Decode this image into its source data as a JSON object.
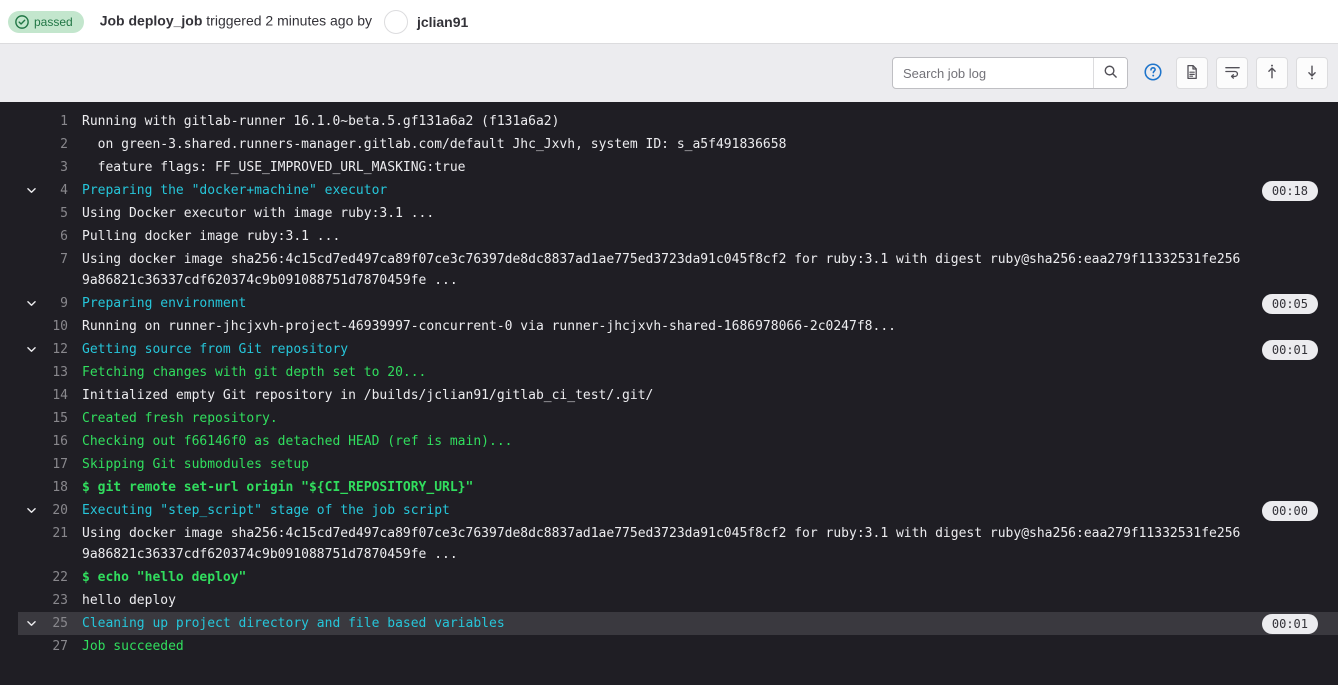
{
  "header": {
    "status_label": "passed",
    "status_icon": "check-circle-icon",
    "status_bg": "#c3e6cd",
    "status_fg": "#217645",
    "job_label": "Job deploy_job",
    "triggered_text": " triggered 2 minutes ago by ",
    "author": "jclian91"
  },
  "toolbar": {
    "search_placeholder": "Search job log",
    "search_value": "",
    "search_icon": "search-icon",
    "help_icon": "question-circle-icon",
    "raw_icon": "document-icon",
    "wrap_icon": "soft-wrap-icon",
    "scroll_top_icon": "scroll-to-top-icon",
    "scroll_bottom_icon": "scroll-to-bottom-icon"
  },
  "log": {
    "lines": [
      {
        "num": "1",
        "text": "Running with gitlab-runner 16.1.0~beta.5.gf131a6a2 (f131a6a2)",
        "style": "c-default",
        "collapsible": false,
        "duration": ""
      },
      {
        "num": "2",
        "text": "  on green-3.shared.runners-manager.gitlab.com/default Jhc_Jxvh, system ID: s_a5f491836658",
        "style": "c-default",
        "collapsible": false,
        "duration": ""
      },
      {
        "num": "3",
        "text": "  feature flags: FF_USE_IMPROVED_URL_MASKING:true",
        "style": "c-default",
        "collapsible": false,
        "duration": ""
      },
      {
        "num": "4",
        "text": "Preparing the \"docker+machine\" executor",
        "style": "c-section",
        "collapsible": true,
        "duration": "00:18"
      },
      {
        "num": "5",
        "text": "Using Docker executor with image ruby:3.1 ...",
        "style": "c-default",
        "collapsible": false,
        "duration": ""
      },
      {
        "num": "6",
        "text": "Pulling docker image ruby:3.1 ...",
        "style": "c-default",
        "collapsible": false,
        "duration": ""
      },
      {
        "num": "7",
        "text": "Using docker image sha256:4c15cd7ed497ca89f07ce3c76397de8dc8837ad1ae775ed3723da91c045f8cf2 for ruby:3.1 with digest ruby@sha256:eaa279f11332531fe2569a86821c36337cdf620374c9b091088751d7870459fe ...",
        "style": "c-default",
        "collapsible": false,
        "duration": ""
      },
      {
        "num": "9",
        "text": "Preparing environment",
        "style": "c-section",
        "collapsible": true,
        "duration": "00:05"
      },
      {
        "num": "10",
        "text": "Running on runner-jhcjxvh-project-46939997-concurrent-0 via runner-jhcjxvh-shared-1686978066-2c0247f8...",
        "style": "c-default",
        "collapsible": false,
        "duration": ""
      },
      {
        "num": "12",
        "text": "Getting source from Git repository",
        "style": "c-section",
        "collapsible": true,
        "duration": "00:01"
      },
      {
        "num": "13",
        "text": "Fetching changes with git depth set to 20...",
        "style": "c-green",
        "collapsible": false,
        "duration": ""
      },
      {
        "num": "14",
        "text": "Initialized empty Git repository in /builds/jclian91/gitlab_ci_test/.git/",
        "style": "c-default",
        "collapsible": false,
        "duration": ""
      },
      {
        "num": "15",
        "text": "Created fresh repository.",
        "style": "c-green",
        "collapsible": false,
        "duration": ""
      },
      {
        "num": "16",
        "text": "Checking out f66146f0 as detached HEAD (ref is main)...",
        "style": "c-green",
        "collapsible": false,
        "duration": ""
      },
      {
        "num": "17",
        "text": "Skipping Git submodules setup",
        "style": "c-green",
        "collapsible": false,
        "duration": ""
      },
      {
        "num": "18",
        "text": "$ git remote set-url origin \"${CI_REPOSITORY_URL}\"",
        "style": "c-green-bold",
        "collapsible": false,
        "duration": ""
      },
      {
        "num": "20",
        "text": "Executing \"step_script\" stage of the job script",
        "style": "c-section",
        "collapsible": true,
        "duration": "00:00"
      },
      {
        "num": "21",
        "text": "Using docker image sha256:4c15cd7ed497ca89f07ce3c76397de8dc8837ad1ae775ed3723da91c045f8cf2 for ruby:3.1 with digest ruby@sha256:eaa279f11332531fe2569a86821c36337cdf620374c9b091088751d7870459fe ...",
        "style": "c-default",
        "collapsible": false,
        "duration": ""
      },
      {
        "num": "22",
        "text": "$ echo \"hello deploy\"",
        "style": "c-green-bold",
        "collapsible": false,
        "duration": ""
      },
      {
        "num": "23",
        "text": "hello deploy",
        "style": "c-default",
        "collapsible": false,
        "duration": ""
      },
      {
        "num": "25",
        "text": "Cleaning up project directory and file based variables",
        "style": "c-section",
        "collapsible": true,
        "duration": "00:01",
        "hovered": true
      },
      {
        "num": "27",
        "text": "Job succeeded",
        "style": "c-green",
        "collapsible": false,
        "duration": ""
      }
    ]
  },
  "colors": {
    "log_bg": "#1f1e24",
    "section_text": "#26c6da",
    "success_text": "#31de5e",
    "default_text": "#ececef",
    "lineno_text": "#89888d",
    "hover_bg": "#3a393f"
  }
}
